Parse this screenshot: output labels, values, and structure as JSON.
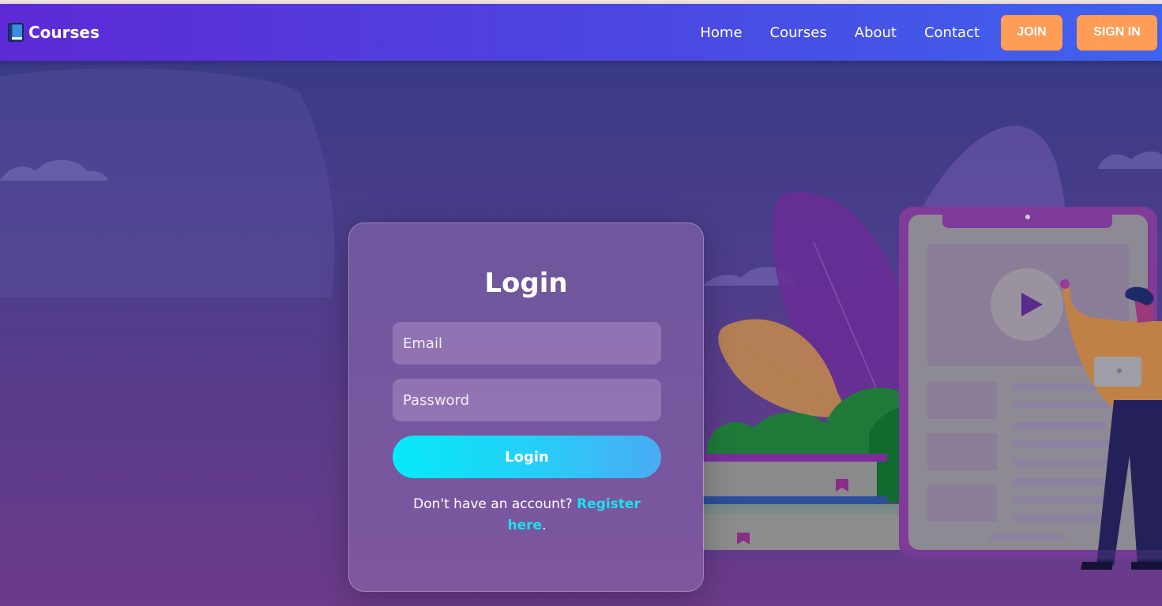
{
  "brand": {
    "name": "Courses",
    "icon": "book-icon"
  },
  "nav": {
    "links": [
      "Home",
      "Courses",
      "About",
      "Contact"
    ],
    "join_label": "JOIN",
    "signin_label": "SIGN IN"
  },
  "login": {
    "title": "Login",
    "email_placeholder": "Email",
    "password_placeholder": "Password",
    "button_label": "Login",
    "register_prompt": "Don't have an account?",
    "register_link": "Register here",
    "register_suffix": "."
  },
  "colors": {
    "nav_gradient_start": "#5d2ad6",
    "nav_gradient_end": "#3f63ee",
    "accent_orange": "#ff9c56",
    "login_button_start": "#06eafa",
    "login_button_end": "#4aabf4",
    "link_cyan": "#19e3ec"
  }
}
